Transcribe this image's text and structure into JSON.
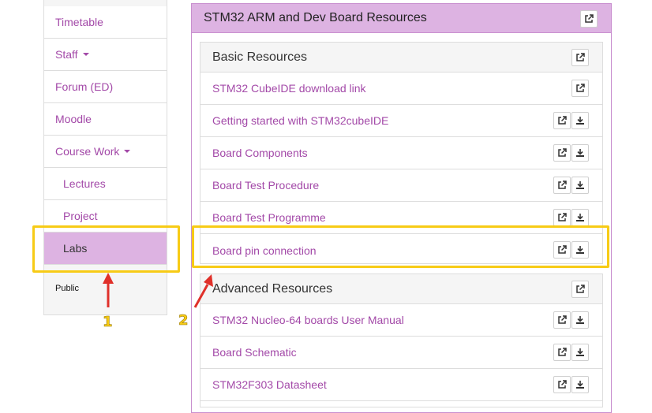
{
  "sidebar": {
    "items": [
      {
        "label": "Timetable"
      },
      {
        "label": "Staff"
      },
      {
        "label": "Forum (ED)"
      },
      {
        "label": "Moodle"
      },
      {
        "label": "Course Work"
      },
      {
        "label": "Lectures"
      },
      {
        "label": "Project"
      },
      {
        "label": "Labs"
      }
    ],
    "public_label": "Public"
  },
  "panel": {
    "title": "STM32 ARM and Dev Board Resources",
    "basic": {
      "title": "Basic Resources",
      "rows": [
        {
          "label": "STM32 CubeIDE download link"
        },
        {
          "label": "Getting started with STM32cubeIDE"
        },
        {
          "label": "Board Components"
        },
        {
          "label": "Board Test Procedure"
        },
        {
          "label": "Board Test Programme"
        },
        {
          "label": "Board pin connection"
        }
      ]
    },
    "advanced": {
      "title": "Advanced Resources",
      "rows": [
        {
          "label": "STM32 Nucleo-64 boards User Manual"
        },
        {
          "label": "Board Schematic"
        },
        {
          "label": "STM32F303 Datasheet"
        }
      ]
    }
  },
  "annotations": {
    "marker_1": "1",
    "marker_2": "2",
    "highlight_color": "#f7cb16",
    "arrow_color": "#e0302a"
  },
  "colors": {
    "accent": "#a349a8",
    "header_bg": "#ddb3e2",
    "active_bg": "#ddb3e2"
  }
}
